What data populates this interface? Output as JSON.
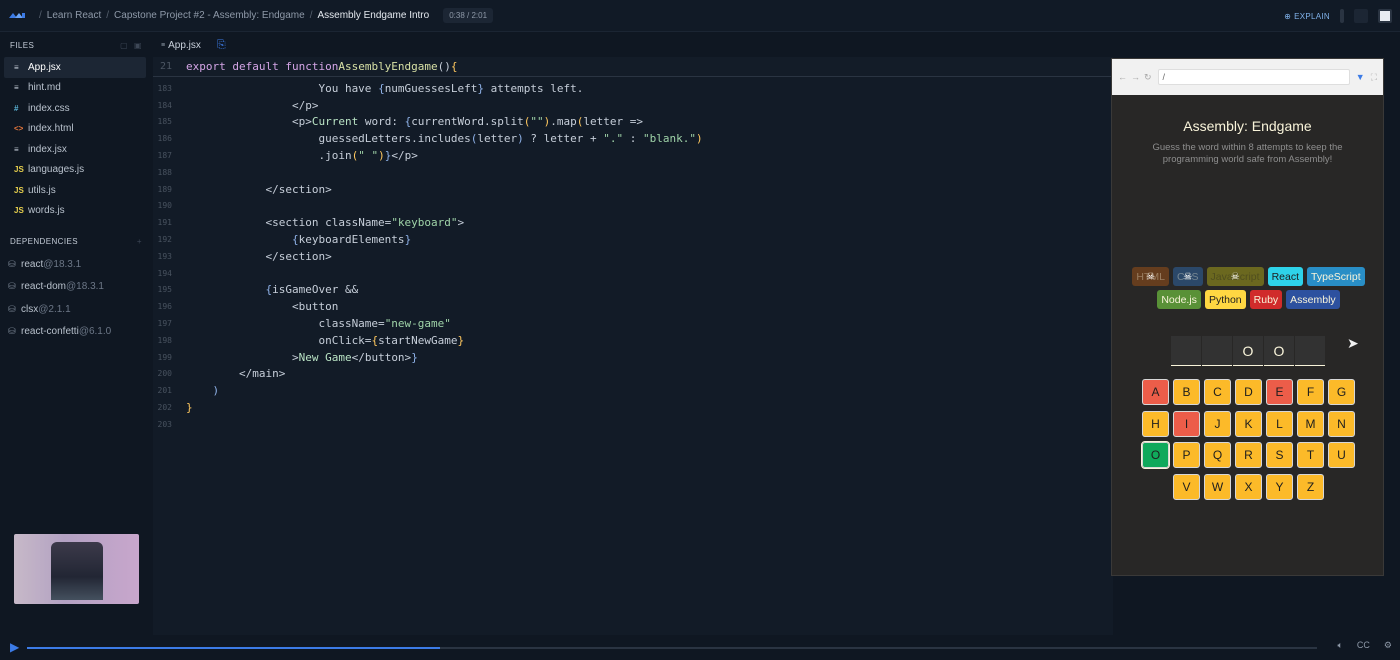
{
  "topbar": {
    "breadcrumbs": [
      "Learn React",
      "Capstone Project #2 - Assembly: Endgame",
      "Assembly Endgame Intro"
    ],
    "timer": "0:38 / 2:01",
    "explain_label": "EXPLAIN"
  },
  "sidebar": {
    "files_title": "FILES",
    "files": [
      {
        "icon": "≡",
        "name": "App.jsx",
        "color": "#c9d1dc"
      },
      {
        "icon": "≡",
        "name": "hint.md",
        "color": "#c9d1dc"
      },
      {
        "icon": "#",
        "name": "index.css",
        "color": "#5bb6d9"
      },
      {
        "icon": "<>",
        "name": "index.html",
        "color": "#e8773c"
      },
      {
        "icon": "≡",
        "name": "index.jsx",
        "color": "#c9d1dc"
      },
      {
        "icon": "JS",
        "name": "languages.js",
        "color": "#e6cf4d"
      },
      {
        "icon": "JS",
        "name": "utils.js",
        "color": "#e6cf4d"
      },
      {
        "icon": "JS",
        "name": "words.js",
        "color": "#e6cf4d"
      }
    ],
    "deps_title": "DEPENDENCIES",
    "deps": [
      {
        "name": "react",
        "version": "@18.3.1"
      },
      {
        "name": "react-dom",
        "version": "@18.3.1"
      },
      {
        "name": "clsx",
        "version": "@2.1.1"
      },
      {
        "name": "react-confetti",
        "version": "@6.1.0"
      }
    ]
  },
  "editor": {
    "tab": "App.jsx",
    "sticky_line_number": "21",
    "sticky_line": {
      "kw": "export default function ",
      "fn": "AssemblyEndgame",
      "rest": "() ",
      "brace": "{"
    },
    "line_numbers": [
      "183",
      "184",
      "185",
      "186",
      "187",
      "188",
      "189",
      "190",
      "191",
      "192",
      "193",
      "194",
      "195",
      "196",
      "197",
      "198",
      "199",
      "200",
      "201",
      "202",
      "203"
    ]
  },
  "preview": {
    "url": "/",
    "title": "Assembly: Endgame",
    "subtitle": "Guess the word within 8 attempts to keep the programming world safe from Assembly!",
    "languages": [
      {
        "name": "HTML",
        "bg": "#e2680f",
        "fg": "#f9f4da",
        "lost": true
      },
      {
        "name": "CSS",
        "bg": "#328af1",
        "fg": "#f9f4da",
        "lost": true
      },
      {
        "name": "JavaScript",
        "bg": "#f4eb13",
        "fg": "#1e1e1e",
        "lost": true
      },
      {
        "name": "React",
        "bg": "#2ed3e9",
        "fg": "#1e1e1e",
        "lost": false
      },
      {
        "name": "TypeScript",
        "bg": "#298ec6",
        "fg": "#f9f4da",
        "lost": false
      },
      {
        "name": "Node.js",
        "bg": "#599137",
        "fg": "#f9f4da",
        "lost": false
      },
      {
        "name": "Python",
        "bg": "#ffd742",
        "fg": "#1e1e1e",
        "lost": false
      },
      {
        "name": "Ruby",
        "bg": "#d02b2b",
        "fg": "#f9f4da",
        "lost": false
      },
      {
        "name": "Assembly",
        "bg": "#2d519f",
        "fg": "#f9f4da",
        "lost": false
      }
    ],
    "word_letters": [
      "",
      "",
      "O",
      "O",
      ""
    ],
    "keyboard_rows": [
      [
        {
          "k": "A",
          "s": "r"
        },
        {
          "k": "B",
          "s": "y"
        },
        {
          "k": "C",
          "s": "y"
        },
        {
          "k": "D",
          "s": "y"
        },
        {
          "k": "E",
          "s": "r"
        },
        {
          "k": "F",
          "s": "y"
        },
        {
          "k": "G",
          "s": "y"
        }
      ],
      [
        {
          "k": "H",
          "s": "y"
        },
        {
          "k": "I",
          "s": "r"
        },
        {
          "k": "J",
          "s": "y"
        },
        {
          "k": "K",
          "s": "y"
        },
        {
          "k": "L",
          "s": "y"
        },
        {
          "k": "M",
          "s": "y"
        },
        {
          "k": "N",
          "s": "y"
        }
      ],
      [
        {
          "k": "O",
          "s": "g"
        },
        {
          "k": "P",
          "s": "y"
        },
        {
          "k": "Q",
          "s": "y"
        },
        {
          "k": "R",
          "s": "y"
        },
        {
          "k": "S",
          "s": "y"
        },
        {
          "k": "T",
          "s": "y"
        },
        {
          "k": "U",
          "s": "y"
        }
      ],
      [
        {
          "k": "V",
          "s": "y"
        },
        {
          "k": "W",
          "s": "y"
        },
        {
          "k": "X",
          "s": "y"
        },
        {
          "k": "Y",
          "s": "y"
        },
        {
          "k": "Z",
          "s": "y"
        }
      ]
    ]
  },
  "player": {
    "progress": 0.32
  }
}
